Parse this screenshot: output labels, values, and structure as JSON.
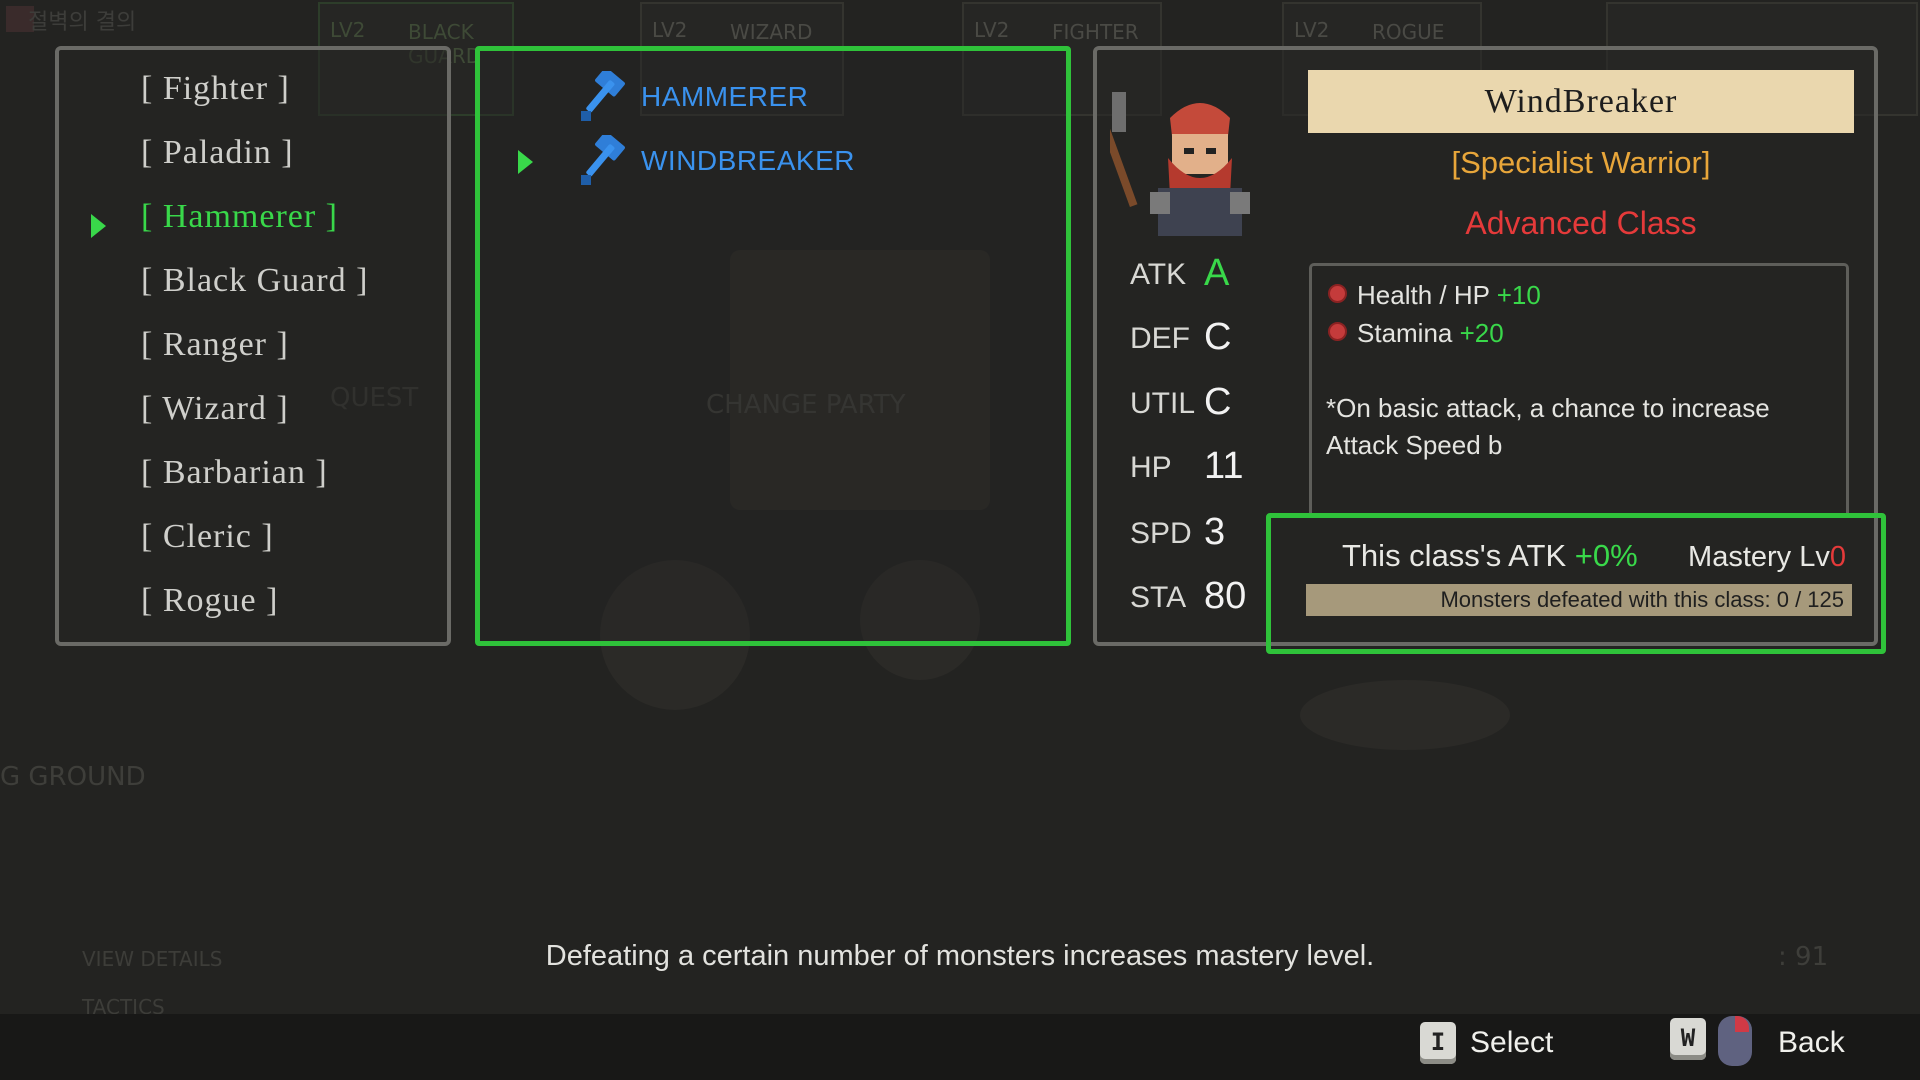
{
  "background": {
    "title": "절벽의 결의",
    "party_cards": [
      {
        "lv": "LV2",
        "name": "BLACK GUARD"
      },
      {
        "lv": "LV2",
        "name": "WIZARD"
      },
      {
        "lv": "LV2",
        "name": "FIGHTER"
      },
      {
        "lv": "LV2",
        "name": "ROGUE"
      }
    ],
    "labels": [
      "QUEST",
      "CHANGE PARTY",
      "G GROUND",
      "VIEW DETAILS",
      "TACTICS"
    ],
    "counter": ": 91"
  },
  "class_list": {
    "items": [
      "[ Fighter ]",
      "[ Paladin ]",
      "[ Hammerer ]",
      "[ Black Guard ]",
      "[ Ranger ]",
      "[ Wizard ]",
      "[ Barbarian ]",
      "[ Cleric ]",
      "[ Rogue ]"
    ],
    "selected_index": 2
  },
  "subclass_list": {
    "items": [
      "HAMMERER",
      "WINDBREAKER"
    ],
    "selected_index": 1,
    "icon": "hammer-icon"
  },
  "detail": {
    "name": "WindBreaker",
    "role": "[Specialist Warrior]",
    "tier": "Advanced Class",
    "stats": [
      {
        "label": "ATK",
        "value": "A"
      },
      {
        "label": "DEF",
        "value": "C"
      },
      {
        "label": "UTIL",
        "value": "C"
      },
      {
        "label": "HP",
        "value": "11"
      },
      {
        "label": "SPD",
        "value": "3"
      },
      {
        "label": "STA",
        "value": "80"
      }
    ],
    "bonuses": [
      {
        "label": "Health / HP",
        "value": "+10"
      },
      {
        "label": "Stamina",
        "value": "+20"
      }
    ],
    "effect": "*On basic attack, a chance to increase Attack Speed b",
    "mastery": {
      "atk_prefix": "This class's ATK ",
      "atk_value": "+0%",
      "level_prefix": "Mastery Lv",
      "level_value": "0",
      "progress_text": "Monsters defeated with this class: 0 / 125",
      "progress_fraction": 0
    }
  },
  "footer": {
    "hint": "Defeating a certain number of monsters increases mastery level.",
    "select_key": "I",
    "select_label": "Select",
    "back_key": "W",
    "back_label": "Back"
  },
  "colors": {
    "accent_green": "#39d84a",
    "subclass_blue": "#3a92ee",
    "role_orange": "#e8a63a",
    "tier_red": "#e53a3a",
    "name_box": "#ead7ae"
  }
}
